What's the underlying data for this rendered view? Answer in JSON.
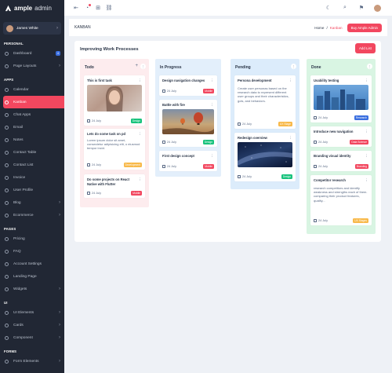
{
  "app": {
    "brand": "ample",
    "brand_suffix": "admin",
    "user_name": "James White"
  },
  "colors": {
    "accent": "#f2475f",
    "sidebar": "#212734",
    "todo": "#fdecee",
    "progress": "#e3effb",
    "pending": "#dcecfb",
    "done": "#d9f5e3"
  },
  "sidebar": {
    "sections": [
      "PERSONAL",
      "APPS",
      "PAGES",
      "UI",
      "FORMS"
    ],
    "personal": [
      {
        "label": "Dashboard",
        "icon": "home-icon",
        "badge": "4"
      },
      {
        "label": "Page Layouts",
        "icon": "layout-icon"
      }
    ],
    "apps": [
      {
        "label": "Calendar",
        "icon": "calendar-icon"
      },
      {
        "label": "Kanban",
        "icon": "kanban-icon"
      },
      {
        "label": "Chat Apps",
        "icon": "chat-icon"
      },
      {
        "label": "Email",
        "icon": "mail-icon"
      },
      {
        "label": "Notes",
        "icon": "notes-icon"
      },
      {
        "label": "Contact Table",
        "icon": "table-icon"
      },
      {
        "label": "Contact List",
        "icon": "list-icon"
      },
      {
        "label": "Invoice",
        "icon": "invoice-icon"
      },
      {
        "label": "User Profile",
        "icon": "user-icon"
      },
      {
        "label": "Blog",
        "icon": "blog-icon"
      },
      {
        "label": "Ecommerce",
        "icon": "cart-icon"
      }
    ],
    "pages": [
      {
        "label": "Pricing",
        "icon": "pricing-icon"
      },
      {
        "label": "FAQ",
        "icon": "faq-icon"
      },
      {
        "label": "Account Settings",
        "icon": "settings-icon"
      },
      {
        "label": "Landing Page",
        "icon": "landing-icon"
      },
      {
        "label": "Widgets",
        "icon": "widgets-icon"
      }
    ],
    "ui": [
      {
        "label": "UI Elements",
        "icon": "elements-icon"
      },
      {
        "label": "Cards",
        "icon": "cards-icon"
      },
      {
        "label": "Component",
        "icon": "component-icon"
      }
    ],
    "forms": [
      {
        "label": "Form Elements",
        "icon": "form-icon"
      }
    ]
  },
  "header": {
    "title": "KANBAN",
    "crumb_home": "Home",
    "crumb_sep": "/",
    "crumb_current": "Kanban",
    "buy_label": "Buy Ample Admin"
  },
  "board": {
    "title": "Improving Work Processes",
    "add_list": "Add List"
  },
  "columns": {
    "todo": {
      "title": "Todo",
      "tasks": [
        {
          "title": "This is first task",
          "date": "24 July",
          "tag": "Design"
        },
        {
          "title": "Lets do some task on pd",
          "desc": "Lorem ipsum dolor sit amet, consectetur adipisicing elit, o eiusmod tempor incid.",
          "date": "24 July",
          "tag": "Development"
        },
        {
          "title": "Do some projects on React Native with Flutter",
          "date": "24 July",
          "tag": "Mobile"
        }
      ]
    },
    "progress": {
      "title": "In Progress",
      "tasks": [
        {
          "title": "Design navigation changes",
          "date": "24 July",
          "tag": "Mobile"
        },
        {
          "title": "Battle with fire",
          "date": "24 July",
          "tag": "Design"
        },
        {
          "title": "First design concept",
          "date": "24 July",
          "tag": "Mobile"
        }
      ]
    },
    "pending": {
      "title": "Pending",
      "tasks": [
        {
          "title": "Persona development",
          "desc": "Create user personas based on the research data to represent different user groups and their characteristics, gols, and behaviors.",
          "date": "24 July",
          "tag": "UX Stage"
        },
        {
          "title": "Redesign overview",
          "date": "24 July",
          "tag": "Design"
        }
      ]
    },
    "done": {
      "title": "Done",
      "tasks": [
        {
          "title": "Usability testing",
          "date": "24 July",
          "tag": "Research"
        },
        {
          "title": "Introduce new navigation",
          "date": "24 July",
          "tag": "Data Science"
        },
        {
          "title": "Branding visual identity",
          "date": "24 July",
          "tag": "Branding"
        },
        {
          "title": "Competitor research",
          "desc": "research competitors and identify weakness and strengths each of them. comparing their product features, quality...",
          "date": "24 July",
          "tag": "UX Stages"
        }
      ]
    }
  }
}
